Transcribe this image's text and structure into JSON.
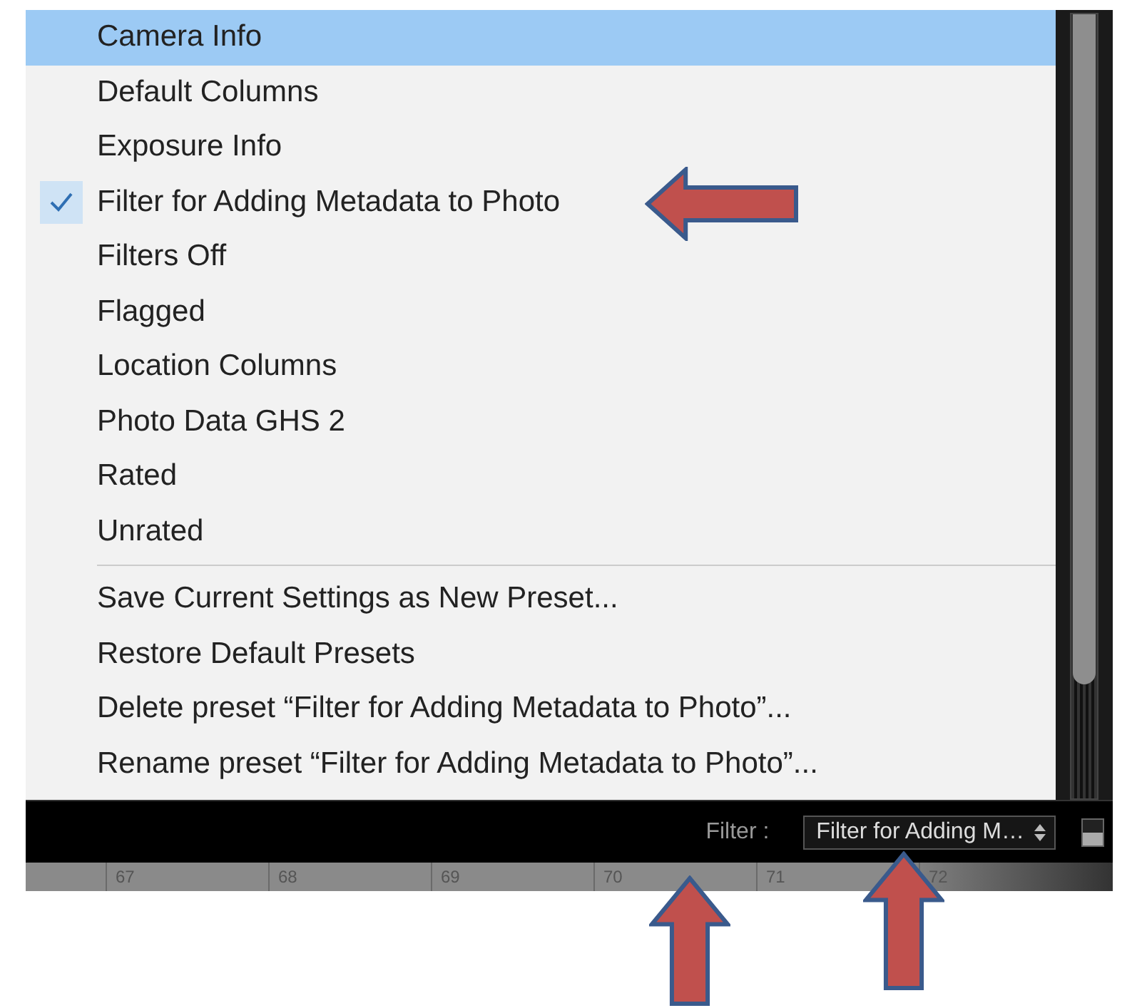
{
  "menu": {
    "presets": [
      {
        "label": "Camera Info",
        "highlighted": true,
        "checked": false
      },
      {
        "label": "Default Columns",
        "highlighted": false,
        "checked": false
      },
      {
        "label": "Exposure Info",
        "highlighted": false,
        "checked": false
      },
      {
        "label": "Filter for Adding Metadata to Photo",
        "highlighted": false,
        "checked": true
      },
      {
        "label": "Filters Off",
        "highlighted": false,
        "checked": false
      },
      {
        "label": "Flagged",
        "highlighted": false,
        "checked": false
      },
      {
        "label": "Location Columns",
        "highlighted": false,
        "checked": false
      },
      {
        "label": "Photo Data GHS 2",
        "highlighted": false,
        "checked": false
      },
      {
        "label": "Rated",
        "highlighted": false,
        "checked": false
      },
      {
        "label": "Unrated",
        "highlighted": false,
        "checked": false
      }
    ],
    "actions": [
      "Save Current Settings as New Preset...",
      "Restore Default Presets",
      "Delete preset “Filter for Adding Metadata to Photo”...",
      "Rename preset “Filter for Adding Metadata to Photo”..."
    ]
  },
  "filter_bar": {
    "label": "Filter :",
    "value": "Filter for Adding M…"
  },
  "column_numbers": [
    "67",
    "68",
    "69",
    "70",
    "71",
    "72"
  ],
  "annotations": [
    {
      "kind": "left_arrow"
    },
    {
      "kind": "up_arrow"
    },
    {
      "kind": "up_arrow"
    }
  ]
}
